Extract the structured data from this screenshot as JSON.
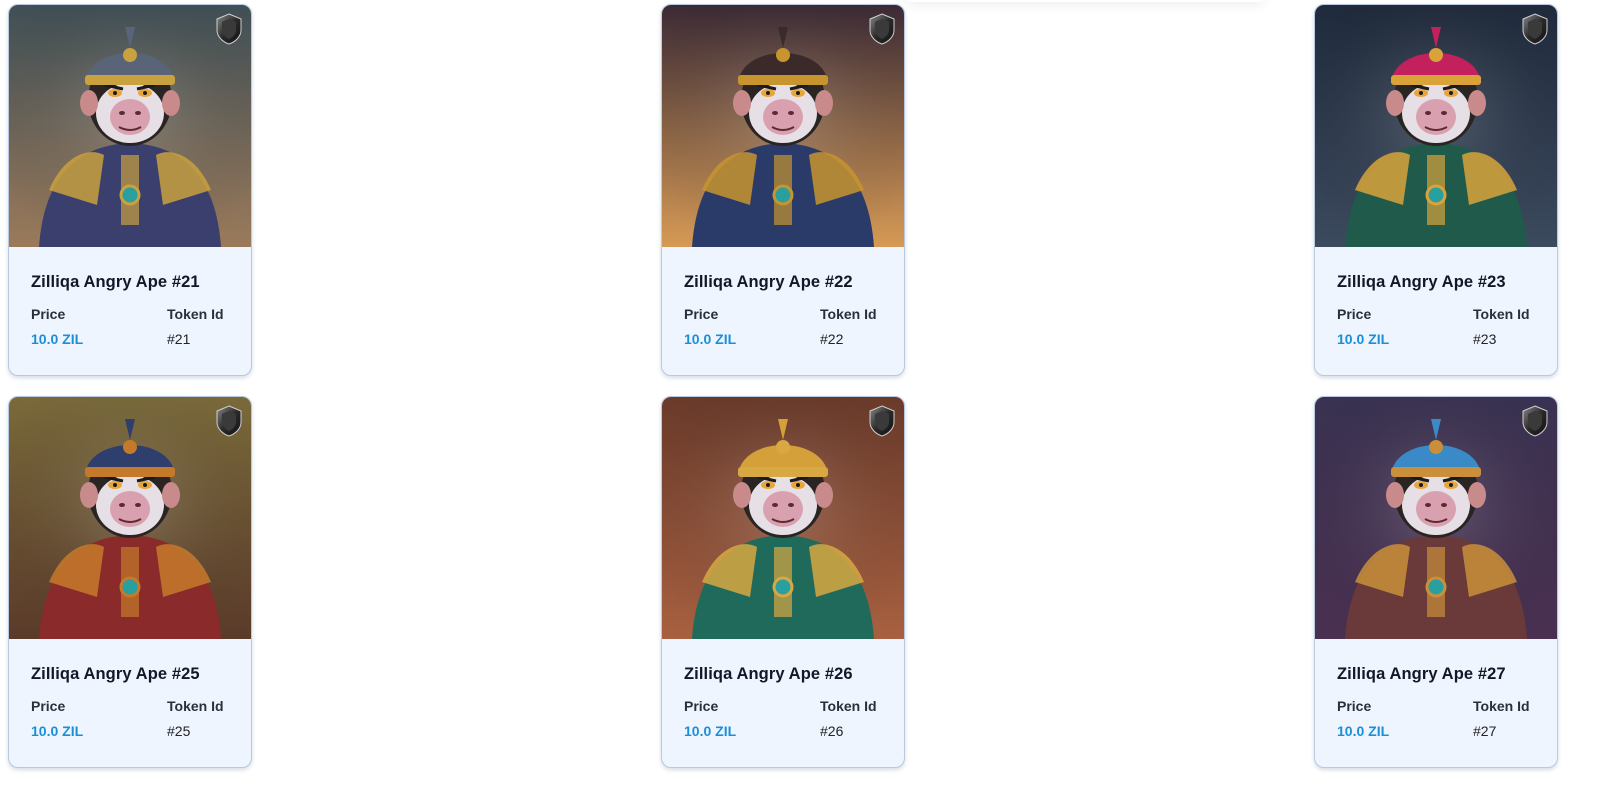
{
  "cards": [
    {
      "title": "Zilliqa Angry Ape #21",
      "price_label": "Price",
      "price": "10.0 ZIL",
      "token_label": "Token Id",
      "token": "#21",
      "bg_top": "#3f4f56",
      "bg_bottom": "#9b7a5a",
      "hat": "#5a6478",
      "accent": "#c9a13e",
      "outfit": "#3a3f6d"
    },
    {
      "title": "Zilliqa Angry Ape #22",
      "price_label": "Price",
      "price": "10.0 ZIL",
      "token_label": "Token Id",
      "token": "#22",
      "bg_top": "#3b2a35",
      "bg_bottom": "#d69a55",
      "hat": "#3a2a2a",
      "accent": "#c8942e",
      "outfit": "#2a3b6a"
    },
    {
      "title": "Zilliqa Angry Ape #23",
      "price_label": "Price",
      "price": "10.0 ZIL",
      "token_label": "Token Id",
      "token": "#23",
      "bg_top": "#1f2a3c",
      "bg_bottom": "#3c4a5e",
      "hat": "#c2215e",
      "accent": "#d9a33a",
      "outfit": "#1f5a4b"
    },
    {
      "title": "Zilliqa Angry Ape #25",
      "price_label": "Price",
      "price": "10.0 ZIL",
      "token_label": "Token Id",
      "token": "#25",
      "bg_top": "#7a6a3a",
      "bg_bottom": "#5a3a2a",
      "hat": "#2e3f6e",
      "accent": "#c47a2a",
      "outfit": "#8a2a2a"
    },
    {
      "title": "Zilliqa Angry Ape #26",
      "price_label": "Price",
      "price": "10.0 ZIL",
      "token_label": "Token Id",
      "token": "#26",
      "bg_top": "#6a3a2a",
      "bg_bottom": "#a86040",
      "hat": "#d3a03a",
      "accent": "#d8a842",
      "outfit": "#1f6a5a"
    },
    {
      "title": "Zilliqa Angry Ape #27",
      "price_label": "Price",
      "price": "10.0 ZIL",
      "token_label": "Token Id",
      "token": "#27",
      "bg_top": "#3a3252",
      "bg_bottom": "#4a3050",
      "hat": "#3a8ac8",
      "accent": "#c98f3a",
      "outfit": "#6a3a3a"
    }
  ],
  "colors": {
    "card_bg": "#eef5ff",
    "price": "#1a8fd8",
    "title": "#111827"
  },
  "icons": {
    "badge": "shield-badge-icon"
  }
}
